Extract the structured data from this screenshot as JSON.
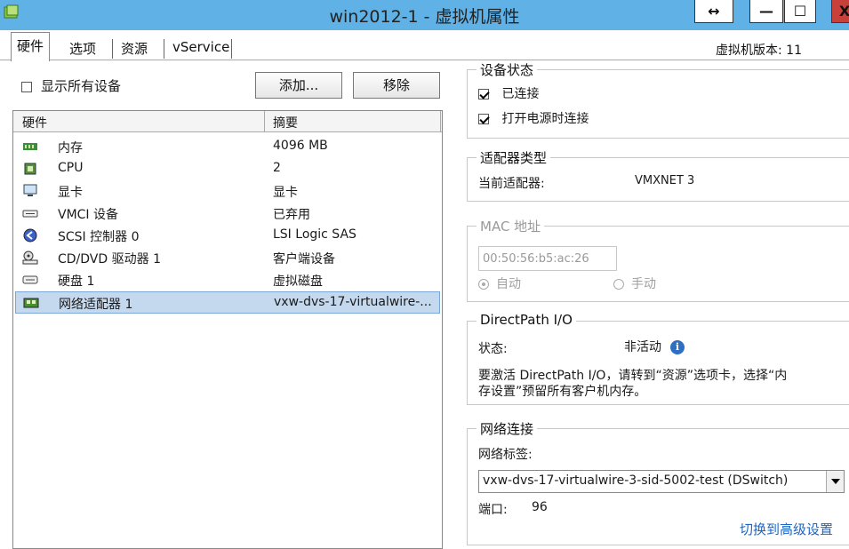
{
  "window": {
    "title": "win2012-1 - 虚拟机属性",
    "resize_glyph": "↔",
    "minimize_glyph": "—",
    "maximize_glyph": "☐",
    "close_glyph": "X"
  },
  "tabs": [
    {
      "label": "硬件",
      "active": true
    },
    {
      "label": "选项"
    },
    {
      "label": "资源"
    },
    {
      "label": "vService"
    }
  ],
  "vm_version": "虚拟机版本: 11",
  "hardware": {
    "show_all_label": "显示所有设备",
    "add_button": "添加...",
    "remove_button": "移除",
    "columns": [
      "硬件",
      "摘要"
    ],
    "rows": [
      {
        "name": "内存",
        "summary": "4096 MB",
        "icon": "memory-icon"
      },
      {
        "name": "CPU",
        "summary": "2",
        "icon": "cpu-icon"
      },
      {
        "name": "显卡",
        "summary": "显卡",
        "icon": "monitor-icon"
      },
      {
        "name": "VMCI 设备",
        "summary": "已弃用",
        "icon": "vmci-icon"
      },
      {
        "name": "SCSI 控制器 0",
        "summary": "LSI Logic SAS",
        "icon": "scsi-icon"
      },
      {
        "name": "CD/DVD 驱动器 1",
        "summary": "客户端设备",
        "icon": "cdrom-icon"
      },
      {
        "name": "硬盘 1",
        "summary": "虚拟磁盘",
        "icon": "harddisk-icon"
      },
      {
        "name": "网络适配器 1",
        "summary": "vxw-dvs-17-virtualwire-...",
        "icon": "network-adapter-icon",
        "selected": true
      }
    ]
  },
  "device_status": {
    "title": "设备状态",
    "connected": "已连接",
    "connect_at_power_on": "打开电源时连接"
  },
  "adapter_type": {
    "title": "适配器类型",
    "current_label": "当前适配器:",
    "current_value": "VMXNET 3"
  },
  "mac": {
    "title": "MAC 地址",
    "value": "00:50:56:b5:ac:26",
    "auto": "自动",
    "manual": "手动"
  },
  "directpath": {
    "title": "DirectPath I/O",
    "status_label": "状态:",
    "status_value": "非活动",
    "info_glyph": "i",
    "note_line1": "要激活 DirectPath I/O，请转到“资源”选项卡，选择“内",
    "note_line2": "存设置”预留所有客户机内存。"
  },
  "network": {
    "title": "网络连接",
    "label_caption": "网络标签:",
    "label_value": "vxw-dvs-17-virtualwire-3-sid-5002-test (DSwitch)",
    "port_label": "端口:",
    "port_value": "96",
    "advanced_link": "切换到高级设置"
  }
}
